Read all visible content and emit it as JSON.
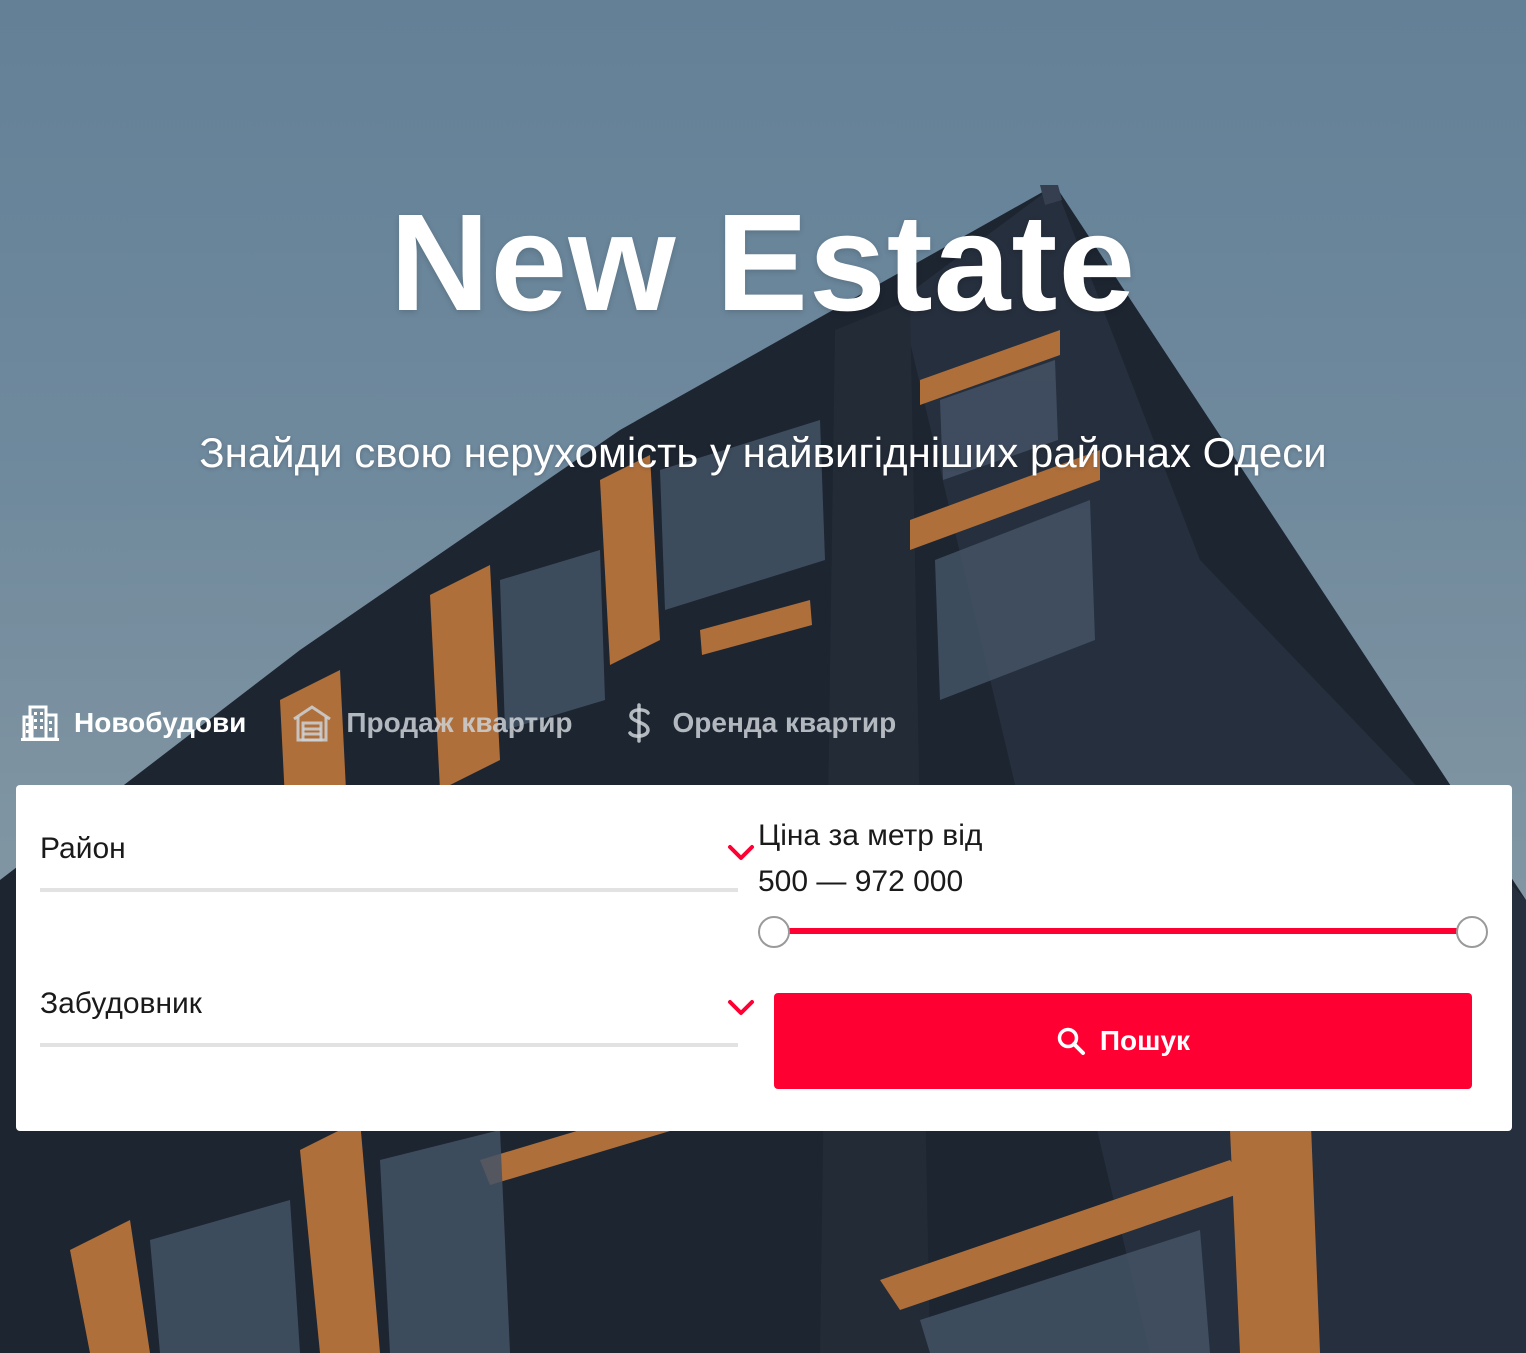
{
  "hero": {
    "title": "New Estate",
    "subtitle": "Знайди свою нерухомість у найвигідніших районах Одеси"
  },
  "tabs": [
    {
      "label": "Новобудови",
      "icon": "building-icon",
      "active": true
    },
    {
      "label": "Продаж квартир",
      "icon": "garage-icon",
      "active": false
    },
    {
      "label": "Оренда квартир",
      "icon": "dollar-icon",
      "active": false
    }
  ],
  "filters": {
    "district_label": "Район",
    "developer_label": "Забудовник",
    "price_label": "Ціна за метр від",
    "price_range": "500 — 972 000",
    "price_min": 500,
    "price_max": 972000
  },
  "search": {
    "label": "Пошук",
    "icon": "search-icon"
  },
  "colors": {
    "accent": "#ff0033",
    "panel": "#ffffff",
    "text": "#1a1a1a"
  }
}
